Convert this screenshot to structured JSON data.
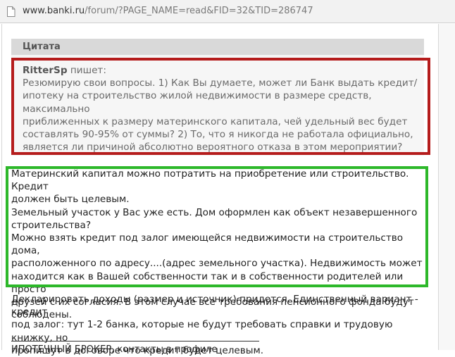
{
  "browser": {
    "url_host": "www.banki.ru",
    "url_path": "/forum/?PAGE_NAME=read&FID=32&TID=286747",
    "page_icon": "page-icon"
  },
  "post": {
    "quote": {
      "heading": "Цитата",
      "author": "RitterSp",
      "says": "пишет:",
      "lines": [
        "Резюмирую свои вопросы. 1) Как Вы думаете, может ли Банк выдать кредит/",
        "ипотеку на строительство жилой недвижимости в размере средств, максимально",
        "приближенных к размеру материнского капитала, чей удельный вес будет",
        "составлять 90-95% от суммы? 2) То, что я никогда не работала официально,",
        "является ли причиной абсолютно вероятного отказа в этом мероприятии?"
      ]
    },
    "answer_lines": [
      "Материнский капитал можно потратить на приобретение или строительство. Кредит",
      "должен быть целевым.",
      "Земельный участок у Вас уже есть. Дом оформлен как объект незавершенного",
      "строительства?",
      "Можно взять кредит под залог имеющейся недвижимости на строительство дома,",
      "расположенного по адресу....(адрес земельного участка). Недвижимость может",
      "находится как в Вашей собственности так и в собственности родителей или просто",
      "друзей с их согласия. В этом случае все требования пенсионного фонда будут",
      "соблюдены."
    ],
    "tail_lines": [
      "Декларировать доходы (размер и источник) придется. Единственный вариант - кредит",
      "под залог: тут 1-2 банка, которые не будут требовать справки и трудовую книжку, но",
      "пропишут в договоре что кредит будет целевым."
    ],
    "signature": "ИПОТЕЧНЫЙ БРОКЕР, контакты в профиле"
  },
  "colors": {
    "highlight_red": "#b51c1c",
    "highlight_green": "#2db82a",
    "quote_header_bg": "#d9d9d9",
    "quote_body_bg": "#f6f6f6"
  }
}
